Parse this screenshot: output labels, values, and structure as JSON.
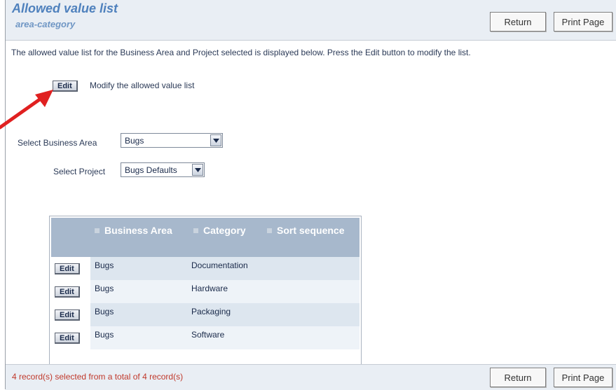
{
  "header": {
    "title": "Allowed value list",
    "subtitle": "area-category",
    "return_label": "Return",
    "print_label": "Print Page"
  },
  "intro_text": "The allowed value list for the Business Area and Project selected is displayed below. Press the Edit button to modify the list.",
  "edit_section": {
    "edit_label": "Edit",
    "description": "Modify the allowed value list"
  },
  "filters": {
    "business_area_label": "Select Business Area",
    "business_area_value": "Bugs",
    "project_label": "Select Project",
    "project_value": "Bugs Defaults"
  },
  "table": {
    "columns": [
      "Business Area",
      "Category",
      "Sort sequence"
    ],
    "rows": [
      {
        "edit": "Edit",
        "business_area": "Bugs",
        "category": "Documentation",
        "sort_sequence": ""
      },
      {
        "edit": "Edit",
        "business_area": "Bugs",
        "category": "Hardware",
        "sort_sequence": ""
      },
      {
        "edit": "Edit",
        "business_area": "Bugs",
        "category": "Packaging",
        "sort_sequence": ""
      },
      {
        "edit": "Edit",
        "business_area": "Bugs",
        "category": "Software",
        "sort_sequence": ""
      }
    ]
  },
  "footer": {
    "status": "4 record(s) selected from a total of 4 record(s)",
    "return_label": "Return",
    "print_label": "Print Page"
  },
  "colors": {
    "title": "#4f81bd",
    "header_bg": "#e9eef4",
    "table_header_bg": "#a7b8cc",
    "row_odd": "#dde6ef",
    "row_even": "#eef3f8",
    "status_text": "#c0392b",
    "annotation_arrow": "#e02020"
  },
  "icons": {
    "dropdown": "chevron-down-icon",
    "annotation": "red-arrow-icon",
    "column_marker": "square-bullet-icon"
  }
}
